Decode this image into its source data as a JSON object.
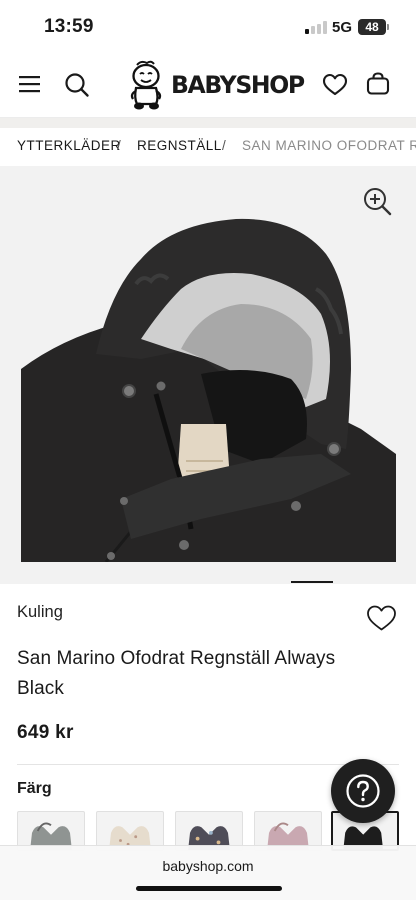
{
  "status_bar": {
    "time": "13:59",
    "network": "5G",
    "battery": "48"
  },
  "header": {
    "logo_text": "BABYSHOP",
    "icons": [
      "menu-icon",
      "search-icon",
      "baby-logo-icon",
      "heart-icon",
      "shopping-bag-icon"
    ]
  },
  "breadcrumb": {
    "items": [
      "YTTERKLÄDER",
      "REGNSTÄLL",
      "SAN MARINO OFODRAT REGNSTÄLL"
    ],
    "separator": "/"
  },
  "product": {
    "image_icon": "zoom-in-icon",
    "brand": "Kuling",
    "title": "San Marino Ofodrat Regnställ Always Black",
    "price": "649 kr",
    "color_label": "Färg",
    "swatches": [
      {
        "color": "#8f9492",
        "selected": false
      },
      {
        "color": "#e6dccd",
        "selected": false
      },
      {
        "color": "#4f4d58",
        "selected": false
      },
      {
        "color": "#c9a8b1",
        "selected": false
      },
      {
        "color": "#1d1d1d",
        "selected": true
      }
    ]
  },
  "help": {
    "icon": "question-mark-icon"
  },
  "browser": {
    "url": "babyshop.com"
  },
  "colors": {
    "accent": "#1a1a1a",
    "breadcrumb_band": "#f0efed",
    "image_bg": "#f2f2f2"
  }
}
